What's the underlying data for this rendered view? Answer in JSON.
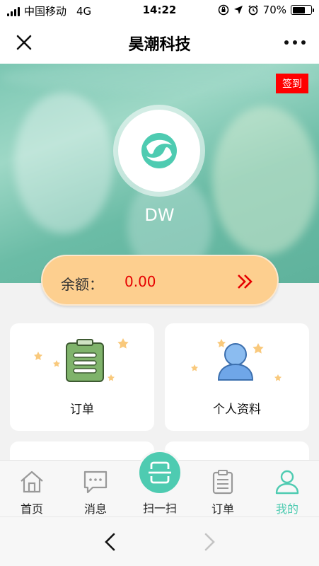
{
  "status_bar": {
    "carrier": "中国移动",
    "network": "4G",
    "time": "14:22",
    "battery": "70%",
    "battery_level": 0.7
  },
  "nav": {
    "title": "昊潮科技",
    "close_icon": "close-icon",
    "more_icon": "more-icon"
  },
  "profile": {
    "checkin_label": "签到",
    "username": "DW",
    "logo_icon": "brand-logo-icon"
  },
  "balance": {
    "label": "余额：",
    "value": "0.00",
    "arrow_icon": "double-chevron-right-icon"
  },
  "cards": [
    {
      "label": "订单",
      "icon": "clipboard-icon"
    },
    {
      "label": "个人资料",
      "icon": "user-icon"
    }
  ],
  "tabbar": {
    "items": [
      {
        "label": "首页",
        "icon": "home-icon"
      },
      {
        "label": "消息",
        "icon": "message-icon"
      },
      {
        "label": "扫一扫",
        "icon": "scan-icon"
      },
      {
        "label": "订单",
        "icon": "order-icon"
      },
      {
        "label": "我的",
        "icon": "profile-icon",
        "active": true
      }
    ]
  },
  "browser": {
    "back_icon": "back-arrow-icon",
    "forward_icon": "forward-arrow-icon"
  },
  "colors": {
    "accent": "#4ecbb1",
    "balance_bg": "#fdcf8f",
    "balance_value": "#e60000",
    "checkin_bg": "#ff0000",
    "card_icon_green": "#7fb36b",
    "card_icon_blue": "#6fa6e8",
    "star": "#f9c97c"
  }
}
